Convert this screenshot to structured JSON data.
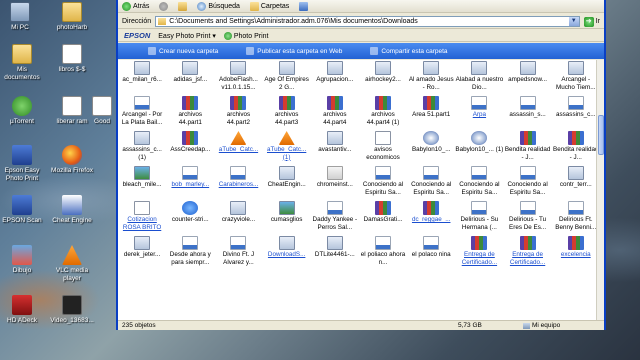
{
  "desktop": {
    "icons": [
      {
        "label": "Mi PC",
        "icon": "my-computer-icon"
      },
      {
        "label": "photoHarb",
        "icon": "folder-icon"
      },
      {
        "label": "Mis documentos",
        "icon": "my-documents-icon"
      },
      {
        "label": "libros $-$",
        "icon": "file-icon"
      },
      {
        "label": "µTorrent",
        "icon": "utorrent-icon"
      },
      {
        "label": "liberar ram",
        "icon": "file-icon"
      },
      {
        "label": "Good",
        "icon": "file-icon"
      },
      {
        "label": "Epson Easy Photo Print",
        "icon": "epson-icon"
      },
      {
        "label": "Mozilla Firefox",
        "icon": "firefox-icon"
      },
      {
        "label": "EPSON Scan",
        "icon": "epson-icon"
      },
      {
        "label": "Cheat Engine",
        "icon": "cheat-engine-icon"
      },
      {
        "label": "Dibujo",
        "icon": "image-icon"
      },
      {
        "label": "VLC media player",
        "icon": "vlc-icon"
      },
      {
        "label": "HD ADeck",
        "icon": "app-icon"
      },
      {
        "label": "Video_13683...",
        "icon": "video-icon"
      }
    ]
  },
  "window": {
    "toolbar": {
      "back": "Atrás",
      "search": "Búsqueda",
      "folders": "Carpetas"
    },
    "address": {
      "label": "Dirección",
      "value": "C:\\Documents and Settings\\Administrador.adm.076\\Mis documentos\\Downloads",
      "go": "Ir"
    },
    "epson": {
      "brand": "EPSON",
      "easy": "Easy Photo Print ▾",
      "photo": "Photo Print"
    },
    "tasks": {
      "new_folder": "Crear nueva carpeta",
      "publish": "Publicar esta carpeta en Web",
      "share": "Compartir esta carpeta"
    },
    "files": [
      {
        "name": "ac_milan_r6...",
        "type": "exe"
      },
      {
        "name": "adidas_jsf...",
        "type": "exe"
      },
      {
        "name": "AdobeFlash... v11.0.1.15...",
        "type": "exe"
      },
      {
        "name": "Age Of Empires 2 G...",
        "type": "exe"
      },
      {
        "name": "Agrupacion...",
        "type": "exe"
      },
      {
        "name": "airhockey2...",
        "type": "exe"
      },
      {
        "name": "Al amado Jesus - Ro...",
        "type": "exe"
      },
      {
        "name": "Alabad a nuestro Dio...",
        "type": "exe"
      },
      {
        "name": "ampedsnow...",
        "type": "exe"
      },
      {
        "name": "Arcangel - Mucho Tiem...",
        "type": "exe"
      },
      {
        "name": "Arcangel - Por La Plata Bail...",
        "type": "mp3"
      },
      {
        "name": "archivos 44.part1",
        "type": "rar"
      },
      {
        "name": "archivos 44.part2",
        "type": "rar"
      },
      {
        "name": "archivos 44.part3",
        "type": "rar"
      },
      {
        "name": "archivos 44.part4",
        "type": "rar"
      },
      {
        "name": "archivos 44.part4 (1)",
        "type": "rar"
      },
      {
        "name": "Area 51.part1",
        "type": "rar"
      },
      {
        "name": "Arpa",
        "type": "mp3",
        "link": true
      },
      {
        "name": "assassin_s...",
        "type": "mp3"
      },
      {
        "name": "assassins_c...",
        "type": "mp3"
      },
      {
        "name": "assassins_c... (1)",
        "type": "exe"
      },
      {
        "name": "AssCreedap...",
        "type": "rar"
      },
      {
        "name": "aTube_Catc...",
        "type": "vlc",
        "link": true
      },
      {
        "name": "aTube_Catc... (1)",
        "type": "vlc",
        "link": true
      },
      {
        "name": "avastantiv...",
        "type": "exe"
      },
      {
        "name": "avisos economicos",
        "type": "doc"
      },
      {
        "name": "Babylon10_...",
        "type": "disc"
      },
      {
        "name": "Babylon10_... (1)",
        "type": "disc"
      },
      {
        "name": "Bendita realidad - J...",
        "type": "rar"
      },
      {
        "name": "Bendita realidad - J...",
        "type": "rar"
      },
      {
        "name": "bleach_mile...",
        "type": "img"
      },
      {
        "name": "bob_marley...",
        "type": "mp3",
        "link": true
      },
      {
        "name": "Carabineros...",
        "type": "mp3",
        "link": true
      },
      {
        "name": "CheatEngin...",
        "type": "exe"
      },
      {
        "name": "chromeinst...",
        "type": "java"
      },
      {
        "name": "Conociendo al Espiritu Sa...",
        "type": "mp3"
      },
      {
        "name": "Conociendo al Espiritu Sa...",
        "type": "mp3"
      },
      {
        "name": "Conociendo al Espiritu Sa...",
        "type": "mp3"
      },
      {
        "name": "Conociendo al Espiritu Sa...",
        "type": "mp3"
      },
      {
        "name": "contr_terr...",
        "type": "exe"
      },
      {
        "name": "Cotizacion ROSA BRITO",
        "type": "doc",
        "link": true
      },
      {
        "name": "counter-stri...",
        "type": "dl"
      },
      {
        "name": "crazyviole...",
        "type": "exe"
      },
      {
        "name": "cumasglios",
        "type": "img"
      },
      {
        "name": "Daddy Yankee - Perros Sal...",
        "type": "mp3"
      },
      {
        "name": "DamasGrati...",
        "type": "rar"
      },
      {
        "name": "dc_reggae_...",
        "type": "rar",
        "link": true
      },
      {
        "name": "Delirious - Su Hermana (...",
        "type": "mp3"
      },
      {
        "name": "Delirious - Tu Eres De Es...",
        "type": "mp3"
      },
      {
        "name": "Delirious Ft. Benny Benni...",
        "type": "mp3"
      },
      {
        "name": "derek_jeter...",
        "type": "exe"
      },
      {
        "name": "Desde ahora y para siempr...",
        "type": "mp3"
      },
      {
        "name": "Divino Ft. J Alvarez y...",
        "type": "mp3"
      },
      {
        "name": "DownloadS...",
        "type": "exe",
        "link": true
      },
      {
        "name": "DTLite4461-...",
        "type": "exe"
      },
      {
        "name": "el poliaco ahora n...",
        "type": "mp3"
      },
      {
        "name": "el polaco nina",
        "type": "mp3"
      },
      {
        "name": "Entrega de Certificado...",
        "type": "rar",
        "link": true
      },
      {
        "name": "Entrega de Certificado...",
        "type": "rar",
        "link": true
      },
      {
        "name": "excelencia",
        "type": "rar",
        "link": true
      }
    ],
    "status": {
      "count": "235 objetos",
      "size": "5,73 GB",
      "computer": "Mi equipo"
    }
  }
}
